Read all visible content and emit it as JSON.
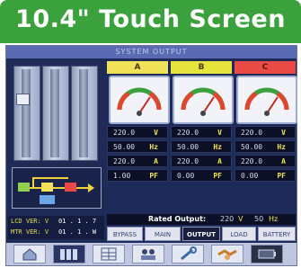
{
  "banner": {
    "title": "10.4\" Touch Screen"
  },
  "screen": {
    "title": "SYSTEM OUTPUT",
    "phases": [
      {
        "label": "A",
        "color": "#f1e25a",
        "gauge_level": 0.85,
        "values": [
          {
            "value": "220.0",
            "unit": "V"
          },
          {
            "value": "50.00",
            "unit": "Hz"
          },
          {
            "value": "220.0",
            "unit": "A"
          },
          {
            "value": "1.00",
            "unit": "PF"
          }
        ]
      },
      {
        "label": "B",
        "color": "#e6e43c",
        "gauge_level": 0.85,
        "values": [
          {
            "value": "220.0",
            "unit": "V"
          },
          {
            "value": "50.00",
            "unit": "Hz"
          },
          {
            "value": "220.0",
            "unit": "A"
          },
          {
            "value": "0.00",
            "unit": "PF"
          }
        ]
      },
      {
        "label": "C",
        "color": "#e94a45",
        "gauge_level": 0.85,
        "values": [
          {
            "value": "220.0",
            "unit": "V"
          },
          {
            "value": "50.00",
            "unit": "Hz"
          },
          {
            "value": "220.0",
            "unit": "A"
          },
          {
            "value": "0.00",
            "unit": "PF"
          }
        ]
      }
    ],
    "rated_output": {
      "label": "Rated Output:",
      "voltage": "220",
      "voltage_unit": "V",
      "frequency": "50",
      "frequency_unit": "Hz"
    },
    "version": {
      "lcd_label": "LCD VER: V",
      "lcd_value": "01 . 1 . 7",
      "mtr_label": "MTR VER: V",
      "mtr_value": "01 . 1 . W"
    },
    "tabs": [
      "BYPASS",
      "MAIN",
      "OUTPUT",
      "LOAD",
      "BATTERY"
    ],
    "active_tab": "OUTPUT",
    "nav_icons": [
      "home-icon",
      "cabinet-icon",
      "grid-icon",
      "users-icon",
      "wrench-icon",
      "handshake-icon",
      "battery-icon"
    ]
  }
}
